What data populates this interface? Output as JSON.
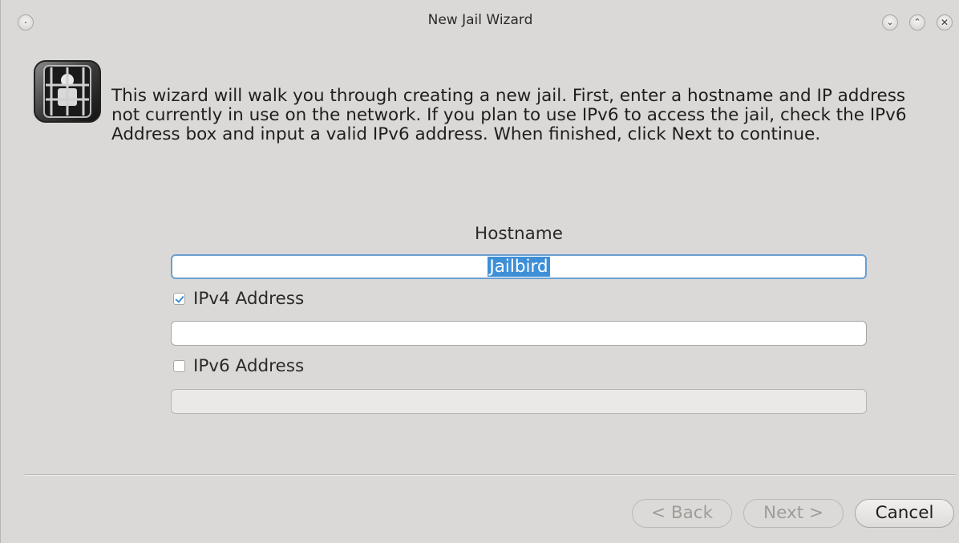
{
  "window": {
    "title": "New Jail Wizard",
    "controls": {
      "minimize_icon": "chevron-down-icon",
      "maximize_icon": "chevron-up-icon",
      "close_icon": "close-icon",
      "minimize_glyph": "⌄",
      "maximize_glyph": "⌃",
      "close_glyph": "✕"
    }
  },
  "intro": {
    "icon": "jail-app-icon",
    "text": "This wizard will walk you through creating a new jail. First, enter a hostname and IP address not currently in use on the network. If you plan to use IPv6 to access the jail, check the IPv6 Address box and input a valid IPv6 address. When finished, click Next to continue."
  },
  "form": {
    "hostname_label": "Hostname",
    "hostname_value": "Jailbird",
    "ipv4": {
      "label": "IPv4 Address",
      "checked": true,
      "value": ""
    },
    "ipv6": {
      "label": "IPv6 Address",
      "checked": false,
      "value": "",
      "enabled": false
    }
  },
  "buttons": {
    "back_label": "< Back",
    "next_label": "Next >",
    "cancel_label": "Cancel",
    "back_enabled": false,
    "next_enabled": false
  },
  "colors": {
    "window_bg": "#dbd9d7",
    "selection": "#3d8fd8",
    "focus_border": "#6a9fd2"
  }
}
